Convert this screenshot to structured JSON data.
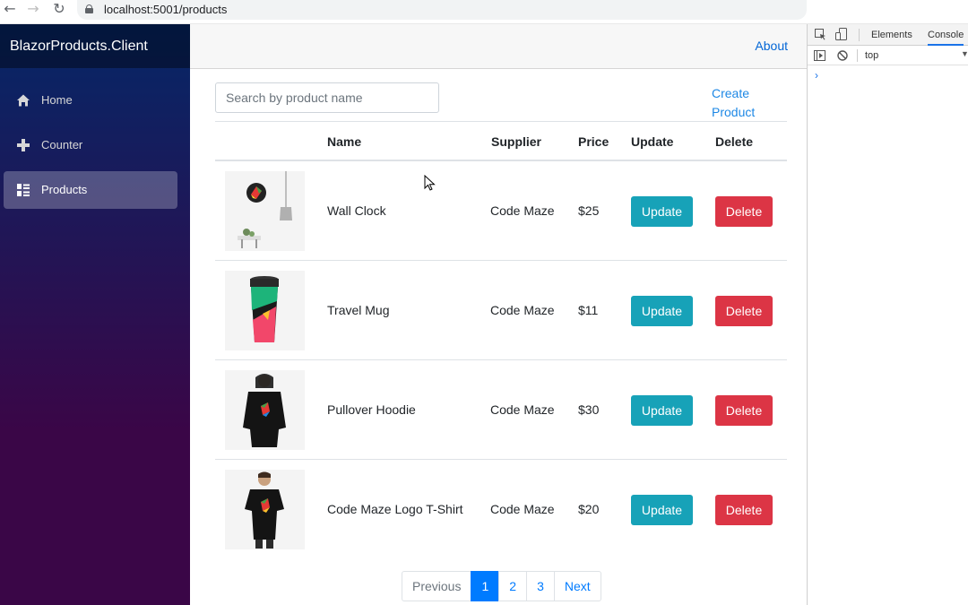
{
  "browser": {
    "url": "localhost:5001/products"
  },
  "sidebar": {
    "brand": "BlazorProducts.Client",
    "items": [
      {
        "label": "Home",
        "icon": "home-icon"
      },
      {
        "label": "Counter",
        "icon": "plus-icon"
      },
      {
        "label": "Products",
        "icon": "list-icon",
        "active": true
      }
    ]
  },
  "topbar": {
    "about_label": "About"
  },
  "products": {
    "search_placeholder": "Search by product name",
    "create_label": "Create Product",
    "columns": [
      "Name",
      "Supplier",
      "Price",
      "Update",
      "Delete"
    ],
    "rows": [
      {
        "name": "Wall Clock",
        "supplier": "Code Maze",
        "price": "$25",
        "update": "Update",
        "delete": "Delete"
      },
      {
        "name": "Travel Mug",
        "supplier": "Code Maze",
        "price": "$11",
        "update": "Update",
        "delete": "Delete"
      },
      {
        "name": "Pullover Hoodie",
        "supplier": "Code Maze",
        "price": "$30",
        "update": "Update",
        "delete": "Delete"
      },
      {
        "name": "Code Maze Logo T-Shirt",
        "supplier": "Code Maze",
        "price": "$20",
        "update": "Update",
        "delete": "Delete"
      }
    ]
  },
  "pagination": {
    "previous": "Previous",
    "pages": [
      "1",
      "2",
      "3"
    ],
    "current": "1",
    "next": "Next"
  },
  "devtools": {
    "tabs": [
      "Elements",
      "Console"
    ],
    "active_tab": "Console",
    "context": "top"
  },
  "colors": {
    "accent": "#007bff",
    "update_button": "#17a2b8",
    "delete_button": "#dc3545"
  }
}
